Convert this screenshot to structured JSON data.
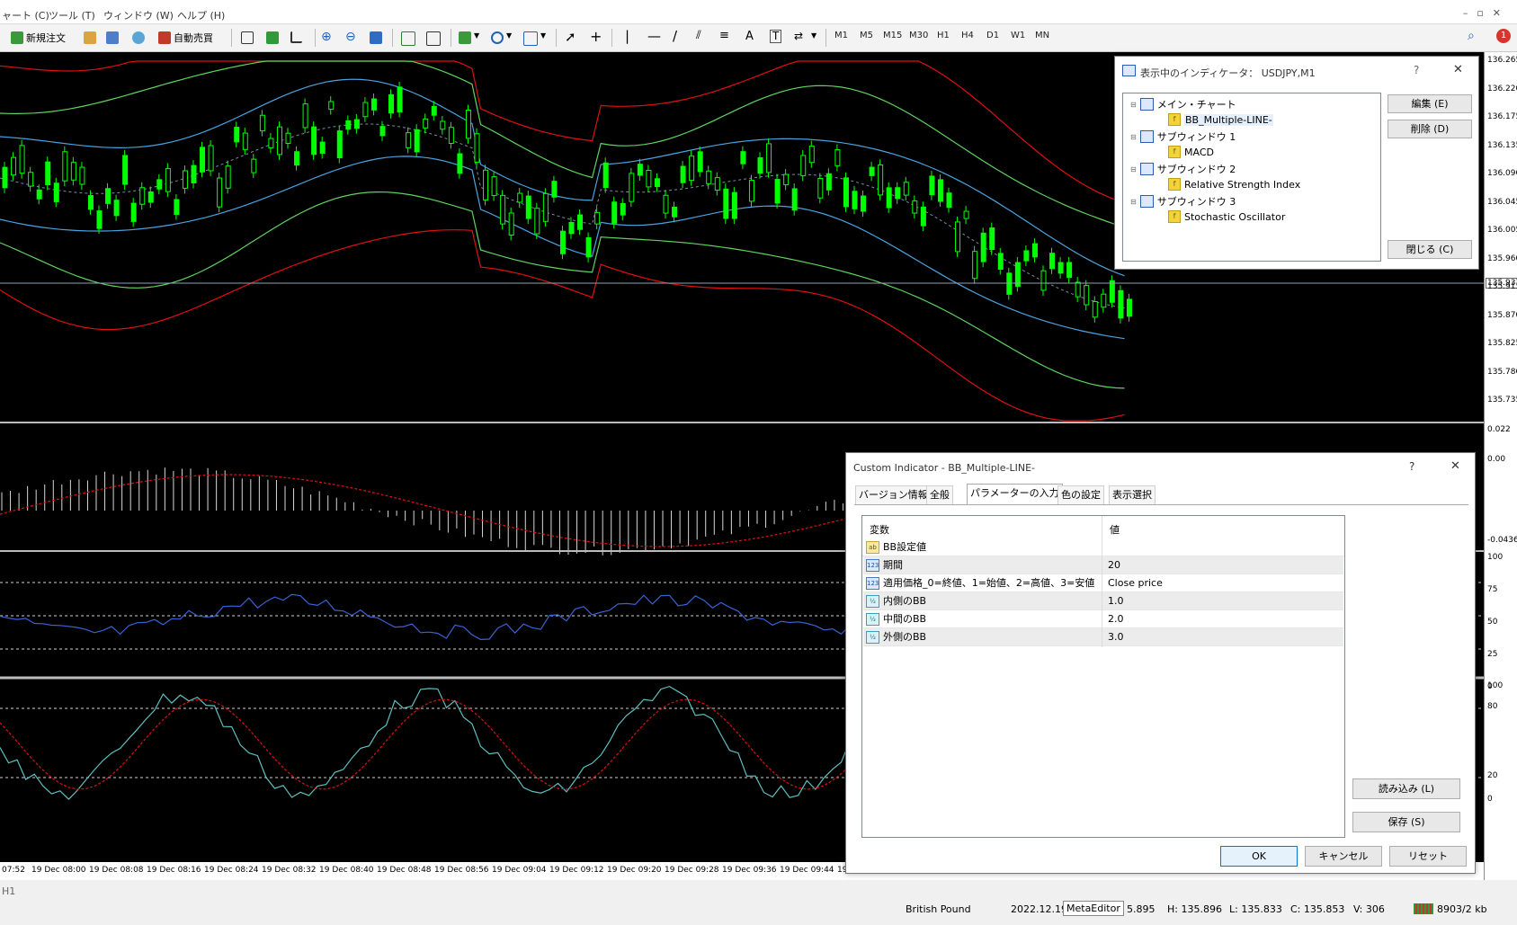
{
  "menu": {
    "items": [
      "ャート (C)",
      "ツール (T)",
      "ウィンドウ (W)",
      "ヘルプ (H)"
    ]
  },
  "toolbar": {
    "new_order": "新規注文",
    "auto_trade": "自動売買",
    "timeframes": [
      "M1",
      "M5",
      "M15",
      "M30",
      "H1",
      "H4",
      "D1",
      "W1",
      "MN"
    ],
    "notification_count": "1"
  },
  "chart": {
    "price_labels": [
      "136.265",
      "136.220",
      "136.175",
      "136.135",
      "136.090",
      "136.045",
      "136.005",
      "135.960",
      "135.937",
      "135.915",
      "135.870",
      "135.825",
      "135.780",
      "135.735"
    ],
    "current_price": "135.937",
    "macd_labels": [
      "0.022",
      "0.00",
      "-0.0436"
    ],
    "rsi_labels": [
      "100",
      "75",
      "50",
      "25",
      "0"
    ],
    "stoch_labels": [
      "100",
      "80",
      "20",
      "0"
    ],
    "time_labels": [
      "07:52",
      "19 Dec 08:00",
      "19 Dec 08:08",
      "19 Dec 08:16",
      "19 Dec 08:24",
      "19 Dec 08:32",
      "19 Dec 08:40",
      "19 Dec 08:48",
      "19 Dec 08:56",
      "19 Dec 09:04",
      "19 Dec 09:12",
      "19 Dec 09:20",
      "19 Dec 09:28",
      "19 Dec 09:36",
      "19 Dec 09:44",
      "19"
    ],
    "colors": {
      "bull": "#00ff00",
      "outer_band": "#e01010",
      "middle_band": "#5fd35f",
      "inner_band": "#4aa3df",
      "rsi_line": "#3a62d8",
      "stoch_main": "#5fbfbf",
      "stoch_signal": "#e01010"
    }
  },
  "indicator_dialog": {
    "title": "表示中のインディケータ： USDJPY,M1",
    "help": "?",
    "close_x": "✕",
    "tree": [
      {
        "label": "メイン・チャート",
        "type": "window"
      },
      {
        "label": "BB_Multiple-LINE-",
        "type": "indicator"
      },
      {
        "label": "サブウィンドウ 1",
        "type": "window"
      },
      {
        "label": "MACD",
        "type": "indicator"
      },
      {
        "label": "サブウィンドウ 2",
        "type": "window"
      },
      {
        "label": "Relative Strength Index",
        "type": "indicator"
      },
      {
        "label": "サブウィンドウ 3",
        "type": "window"
      },
      {
        "label": "Stochastic Oscillator",
        "type": "indicator"
      }
    ],
    "buttons": {
      "edit": "編集 (E)",
      "delete": "削除 (D)",
      "close": "閉じる (C)"
    }
  },
  "custom_dialog": {
    "title": "Custom Indicator - BB_Multiple-LINE-",
    "help": "?",
    "close_x": "✕",
    "tabs": [
      "バージョン情報",
      "全般",
      "パラメーターの入力",
      "色の設定",
      "表示選択"
    ],
    "selected_tab": "パラメーターの入力",
    "columns": {
      "name": "変数",
      "value": "値"
    },
    "params": [
      {
        "icon": "ab",
        "name": "BB設定値",
        "value": ""
      },
      {
        "icon": "123",
        "name": "期間",
        "value": "20"
      },
      {
        "icon": "123",
        "name": "適用価格_0=終値、1=始値、2=高値、3=安値",
        "value": "Close price"
      },
      {
        "icon": "½",
        "name": "内側のBB",
        "value": "1.0"
      },
      {
        "icon": "½",
        "name": "中間のBB",
        "value": "2.0"
      },
      {
        "icon": "½",
        "name": "外側のBB",
        "value": "3.0"
      }
    ],
    "buttons": {
      "load": "読み込み (L)",
      "save": "保存 (S)",
      "ok": "OK",
      "cancel": "キャンセル",
      "reset": "リセット"
    }
  },
  "status": {
    "left": "H1",
    "symbol": "British Pound",
    "date": "2022.12.19",
    "editor": "MetaEditor",
    "open": "5.895",
    "high": "H: 135.896",
    "low": "L: 135.833",
    "close": "C: 135.853",
    "volume": "V: 306",
    "traffic": "8903/2 kb"
  }
}
